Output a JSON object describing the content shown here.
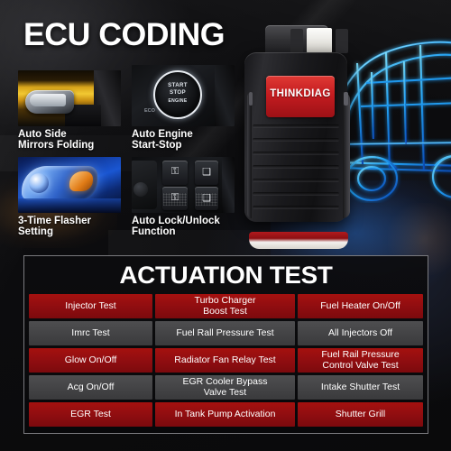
{
  "headline": "ECU CODING",
  "device": {
    "brand": "THINKDIAG",
    "name": "thinkdiag-obd-dongle"
  },
  "features": [
    {
      "caption": "Auto Side\nMirrors Folding",
      "image": "side-mirror-motion-blur"
    },
    {
      "caption": "Auto Engine\nStart-Stop",
      "image": "engine-start-stop-button"
    },
    {
      "caption": "3-Time Flasher\nSetting",
      "image": "blue-headlight"
    },
    {
      "caption": "Auto Lock/Unlock\nFunction",
      "image": "door-lock-switches"
    }
  ],
  "start_stop_button": {
    "line1": "START",
    "line2": "STOP",
    "line3": "ENGINE",
    "sublabel": "ECO"
  },
  "lock_icons": {
    "locked": "⚿",
    "unlocked": "⚿",
    "window_up": "❑",
    "window_down": "❑"
  },
  "panel": {
    "title": "ACTUATION TEST",
    "rows": [
      {
        "style": "red",
        "cells": [
          "Injector Test",
          "Turbo Charger\nBoost Test",
          "Fuel Heater On/Off"
        ]
      },
      {
        "style": "gray",
        "cells": [
          "Imrc Test",
          "Fuel Rall Pressure Test",
          "All Injectors Off"
        ]
      },
      {
        "style": "red",
        "cells": [
          "Glow On/Off",
          "Radiator Fan Relay Test",
          "Fuel Rail Pressure\nControl Valve Test"
        ]
      },
      {
        "style": "gray",
        "cells": [
          "Acg On/Off",
          "EGR Cooler Bypass\nValve Test",
          "Intake Shutter Test"
        ]
      },
      {
        "style": "red",
        "cells": [
          "EGR Test",
          "In Tank Pump Activation",
          "Shutter Grill"
        ]
      }
    ]
  },
  "colors": {
    "red_cell": "#8e0d10",
    "gray_cell": "#434345",
    "brand_red": "#c41c20",
    "wireframe_blue": "#22a8ff",
    "background": "#0a0a0c",
    "text": "#ffffff"
  }
}
